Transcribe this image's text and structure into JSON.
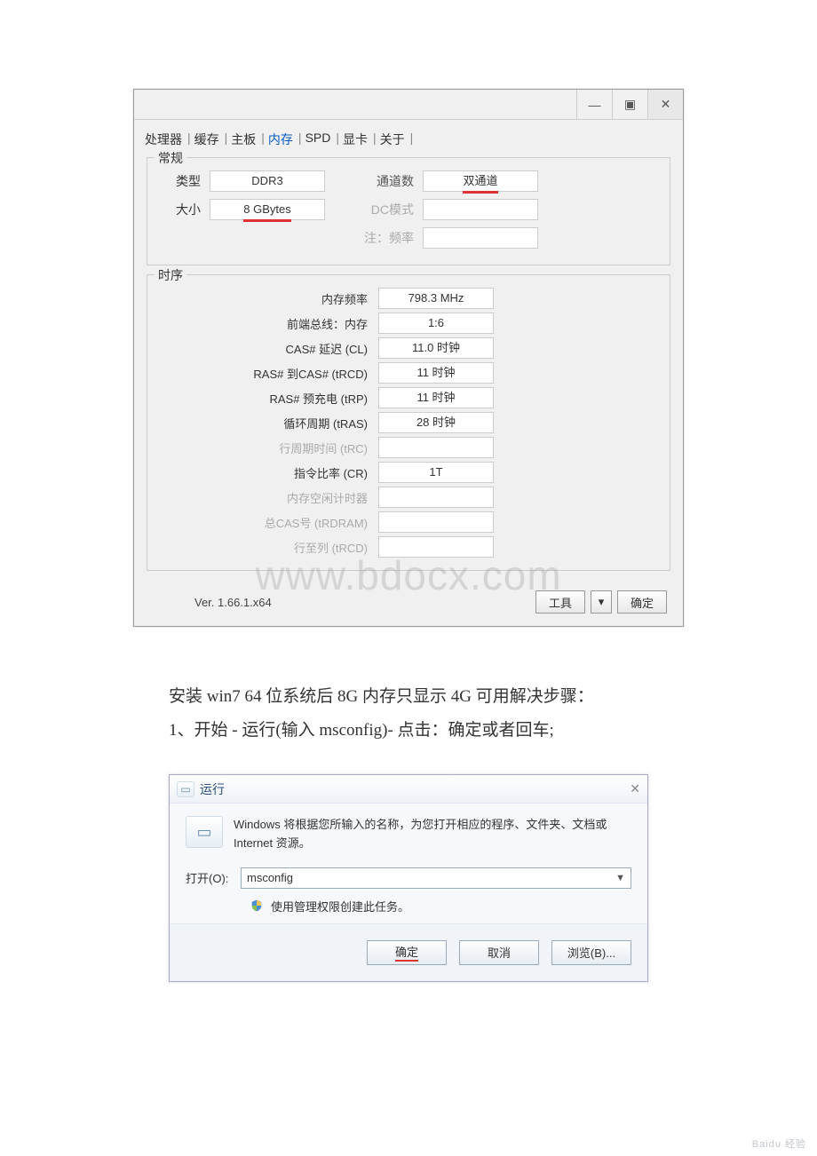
{
  "cpuz": {
    "titlebar": {
      "min": "—",
      "max": "▣",
      "close": "✕"
    },
    "tabs": [
      "处理器",
      "缓存",
      "主板",
      "内存",
      "SPD",
      "显卡",
      "关于"
    ],
    "active_tab": "内存",
    "general": {
      "legend": "常规",
      "type_label": "类型",
      "type_value": "DDR3",
      "size_label": "大小",
      "size_value": "8 GBytes",
      "channels_label": "通道数",
      "channels_value": "双通道",
      "dcmode_label": "DC模式",
      "dcmode_value": "",
      "note_label": "注：频率",
      "note_value": ""
    },
    "timings": {
      "legend": "时序",
      "rows": [
        {
          "label": "内存频率",
          "value": "798.3 MHz",
          "gray": false
        },
        {
          "label": "前端总线：内存",
          "value": "1:6",
          "gray": false
        },
        {
          "label": "CAS# 延迟 (CL)",
          "value": "11.0 时钟",
          "gray": false
        },
        {
          "label": "RAS# 到CAS# (tRCD)",
          "value": "11 时钟",
          "gray": false
        },
        {
          "label": "RAS# 预充电 (tRP)",
          "value": "11 时钟",
          "gray": false
        },
        {
          "label": "循环周期 (tRAS)",
          "value": "28 时钟",
          "gray": false
        },
        {
          "label": "行周期时间 (tRC)",
          "value": "",
          "gray": true
        },
        {
          "label": "指令比率 (CR)",
          "value": "1T",
          "gray": false
        },
        {
          "label": "内存空闲计时器",
          "value": "",
          "gray": true
        },
        {
          "label": "总CAS号 (tRDRAM)",
          "value": "",
          "gray": true
        },
        {
          "label": "行至列 (tRCD)",
          "value": "",
          "gray": true
        }
      ]
    },
    "watermark": "www.bdocx.com",
    "version": "Ver. 1.66.1.x64",
    "tools_btn": "工具",
    "ok_btn": "确定"
  },
  "article": {
    "line1": "安装 win7 64 位系统后 8G 内存只显示 4G 可用解决步骤：",
    "line2": "1、开始 - 运行(输入 msconfig)- 点击：确定或者回车;"
  },
  "run": {
    "title": "运行",
    "close": "✕",
    "desc": "Windows 将根据您所输入的名称，为您打开相应的程序、文件夹、文档或 Internet 资源。",
    "open_label": "打开(O):",
    "open_value": "msconfig",
    "shield_text": "使用管理权限创建此任务。",
    "ok": "确定",
    "cancel": "取消",
    "browse": "浏览(B)...",
    "corner_mark": "Baidu 经验"
  }
}
